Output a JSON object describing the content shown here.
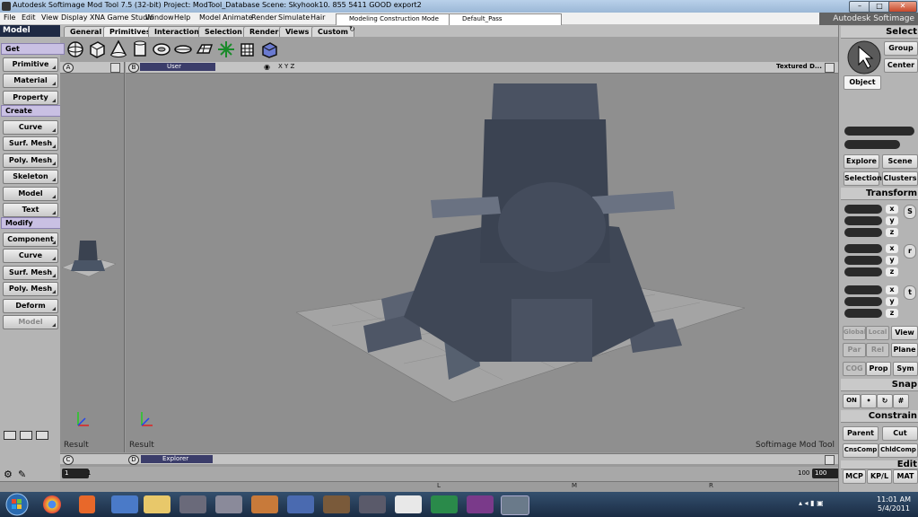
{
  "window": {
    "title": "Autodesk Softimage Mod Tool 7.5 (32-bit)    Project: ModTool_Database    Scene: Skyhook10. 855 5411  GOOD export2",
    "brand": "Autodesk Softimage"
  },
  "menubar": {
    "items": [
      "File",
      "Edit",
      "View",
      "Display",
      "XNA Game Studio",
      "Window",
      "Help",
      "Model",
      "Animate",
      "Render",
      "Simulate",
      "Hair"
    ],
    "construction_mode": "Modeling Construction Mode",
    "pass": "Default_Pass"
  },
  "mode_selector": "Model",
  "toolbar_tabs": [
    "General",
    "Primitives",
    "Interaction",
    "Selection",
    "Render",
    "Views",
    "Custom"
  ],
  "active_tab": "Primitives",
  "left_panel": {
    "sections": [
      {
        "header": "Get",
        "buttons": [
          "Primitive",
          "Material",
          "Property"
        ]
      },
      {
        "header": "Create",
        "buttons": [
          "Curve",
          "Surf. Mesh",
          "Poly. Mesh",
          "Skeleton",
          "Model",
          "Text"
        ]
      },
      {
        "header": "Modify",
        "buttons": [
          "Component",
          "Curve",
          "Surf. Mesh",
          "Poly. Mesh",
          "Deform",
          "Model"
        ]
      }
    ]
  },
  "viewport_a": {
    "letter": "A",
    "result": "Result"
  },
  "viewport_b": {
    "letter": "B",
    "camera": "User",
    "axes": "X Y Z",
    "display_mode": "Textured D...",
    "result": "Result",
    "watermark": "Softimage Mod Tool"
  },
  "explorer_bar": {
    "letter": "C",
    "letter2": "D",
    "label": "Explorer"
  },
  "timeline": {
    "start": "1",
    "frame": "1",
    "end_value": "100",
    "end_box": "100"
  },
  "status_bar": {
    "left": "L",
    "middle": "M",
    "right": "R"
  },
  "right_panel": {
    "select_header": "Select",
    "group_btn": "Group",
    "center_btn": "Center",
    "object_btn": "Object",
    "explore_btn": "Explore",
    "scene_btn": "Scene",
    "selection_btn": "Selection",
    "clusters_btn": "Clusters",
    "transform_header": "Transform",
    "s_label": "S",
    "r_label": "r",
    "t_label": "t",
    "axes": [
      "x",
      "y",
      "z"
    ],
    "global_btn": "Global",
    "local_btn": "Local",
    "view_btn": "View",
    "par_btn": "Par",
    "rel_btn": "Rel",
    "plane_btn": "Plane",
    "cog_btn": "COG",
    "prop_btn": "Prop",
    "sym_btn": "Sym",
    "snap_header": "Snap",
    "snap_on": "ON",
    "constrain_header": "Constrain",
    "parent_btn": "Parent",
    "cut_btn": "Cut",
    "cnscomp_btn": "CnsComp",
    "chldcomp_btn": "ChldComp",
    "edit_header": "Edit",
    "mcp_btn": "MCP",
    "kpl_btn": "KP/L",
    "mat_btn": "MAT"
  },
  "taskbar": {
    "time": "11:01 AM",
    "date": "5/4/2011"
  }
}
